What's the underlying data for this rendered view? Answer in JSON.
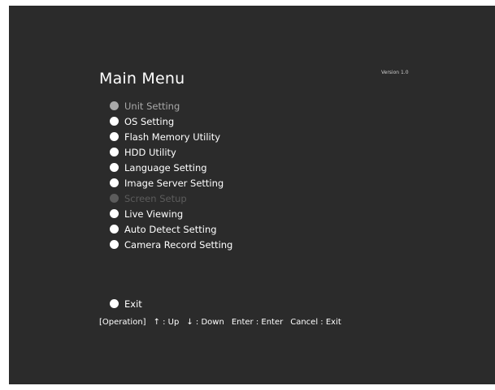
{
  "menu": {
    "title": "Main Menu",
    "version": "Version 1.0",
    "items": [
      {
        "label": "Unit Setting",
        "state": "selected"
      },
      {
        "label": "OS Setting",
        "state": "normal"
      },
      {
        "label": "Flash Memory Utility",
        "state": "normal"
      },
      {
        "label": "HDD Utility",
        "state": "normal"
      },
      {
        "label": "Language Setting",
        "state": "normal"
      },
      {
        "label": "Image Server Setting",
        "state": "normal"
      },
      {
        "label": "Screen Setup",
        "state": "disabled"
      },
      {
        "label": "Live Viewing",
        "state": "normal"
      },
      {
        "label": "Auto Detect Setting",
        "state": "normal"
      },
      {
        "label": "Camera Record Setting",
        "state": "normal"
      }
    ],
    "exit_label": "Exit"
  },
  "operation": {
    "heading": "[Operation]",
    "up": "↑ : Up",
    "down": "↓ : Down",
    "enter": "Enter : Enter",
    "cancel": "Cancel : Exit"
  },
  "colors": {
    "background": "#2b2b2b",
    "text": "#ffffff",
    "selected": "#a9a9a9",
    "disabled": "#5c5c5c"
  }
}
